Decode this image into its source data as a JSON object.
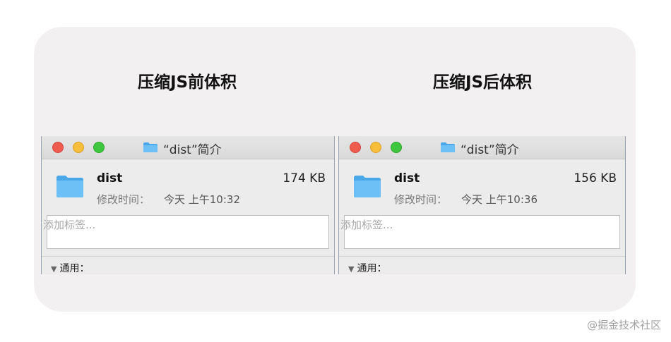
{
  "headings": {
    "before": "压缩JS前体积",
    "after": "压缩JS后体积"
  },
  "windows": [
    {
      "title": "“dist”简介",
      "file_name": "dist",
      "size": "174 KB",
      "modified_label": "修改时间：",
      "modified_value": "今天 上午10:32",
      "tags_placeholder": "添加标签...",
      "section_label": "通用："
    },
    {
      "title": "“dist”简介",
      "file_name": "dist",
      "size": "156 KB",
      "modified_label": "修改时间：",
      "modified_value": "今天 上午10:36",
      "tags_placeholder": "添加标签...",
      "section_label": "通用："
    }
  ],
  "watermark": "@掘金技术社区",
  "icons": {
    "close": "close-button",
    "minimize": "minimize-button",
    "zoom": "zoom-button",
    "folder": "folder-icon",
    "disclosure": "disclosure-triangle-icon"
  },
  "colors": {
    "folder": "#5bb5f0",
    "close": "#f05b50",
    "minimize": "#f6be3a",
    "zoom": "#3ec63f"
  }
}
